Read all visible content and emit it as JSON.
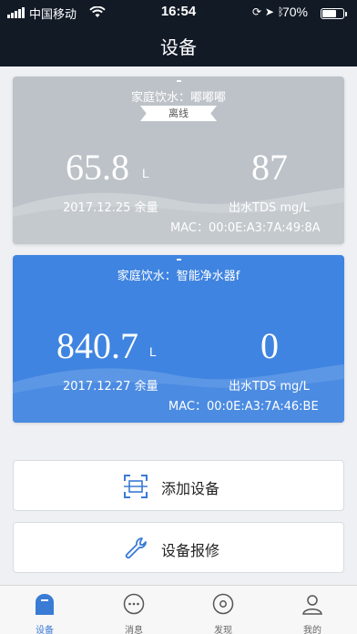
{
  "status_bar": {
    "carrier": "中国移动",
    "time": "16:54",
    "battery_percent": "70%",
    "battery_level": 0.7,
    "icons": [
      "signal-icon",
      "wifi-icon",
      "orientation-lock-icon",
      "location-icon",
      "bluetooth-icon",
      "battery-icon"
    ]
  },
  "header": {
    "title": "设备"
  },
  "devices": [
    {
      "name": "家庭饮水：嘟嘟嘟",
      "status_badge": "离线",
      "remaining_value": "65.8",
      "remaining_unit": "L",
      "remaining_label": "2017.12.25 余量",
      "tds_value": "87",
      "tds_label": "出水TDS mg/L",
      "mac": "MAC：00:0E:A3:7A:49:8A",
      "color": "#bcc2c8"
    },
    {
      "name": "家庭饮水：智能净水器f",
      "remaining_value": "840.7",
      "remaining_unit": "L",
      "remaining_label": "2017.12.27 余量",
      "tds_value": "0",
      "tds_label": "出水TDS mg/L",
      "mac": "MAC：00:0E:A3:7A:46:BE",
      "color": "#3f84e0"
    }
  ],
  "actions": {
    "add_device": {
      "label": "添加设备",
      "icon": "scan-icon"
    },
    "repair": {
      "label": "设备报修",
      "icon": "wrench-icon"
    }
  },
  "tabbar": {
    "items": [
      {
        "label": "设备",
        "icon": "device-icon",
        "active": true
      },
      {
        "label": "消息",
        "icon": "message-icon",
        "active": false
      },
      {
        "label": "发现",
        "icon": "discover-icon",
        "active": false
      },
      {
        "label": "我的",
        "icon": "profile-icon",
        "active": false
      }
    ]
  },
  "colors": {
    "accent": "#3a7bd5",
    "header_bg": "#121a26",
    "offline_card": "#bcc2c8",
    "online_card": "#3f84e0"
  }
}
